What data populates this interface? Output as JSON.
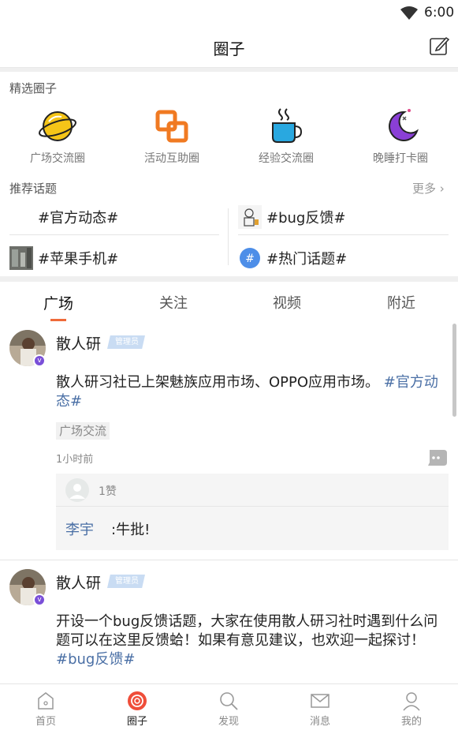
{
  "status_bar": {
    "time": "6:00"
  },
  "header": {
    "title": "圈子"
  },
  "featured": {
    "label": "精选圈子",
    "circles": [
      {
        "label": "广场交流圈",
        "icon": "planet-icon"
      },
      {
        "label": "活动互助圈",
        "icon": "link-squares-icon"
      },
      {
        "label": "经验交流圈",
        "icon": "coffee-cup-icon"
      },
      {
        "label": "晚睡打卡圈",
        "icon": "moon-icon"
      }
    ]
  },
  "topics": {
    "label": "推荐话题",
    "more": "更多",
    "items": [
      {
        "text": "#官方动态#"
      },
      {
        "text": "#bug反馈#"
      },
      {
        "text": "#苹果手机#"
      },
      {
        "text": "#热门话题#"
      }
    ]
  },
  "tabs": [
    "广场",
    "关注",
    "视频",
    "附近"
  ],
  "posts": [
    {
      "author": "散人研",
      "badge": "管理员",
      "content": "散人研习社已上架魅族应用市场、OPPO应用市场。",
      "hashtag": "#官方动态#",
      "circle_tag": "广场交流",
      "time": "1小时前",
      "likes": "1赞",
      "comment_user": "李宇",
      "comment_text": ":牛批!"
    },
    {
      "author": "散人研",
      "badge": "管理员",
      "content": "开设一个bug反馈话题，大家在使用散人研习社时遇到什么问题可以在这里反馈蛤！如果有意见建议，也欢迎一起探讨！",
      "hashtag": "#bug反馈#"
    }
  ],
  "bottom_nav": [
    {
      "label": "首页",
      "icon": "home-icon"
    },
    {
      "label": "圈子",
      "icon": "circle-target-icon"
    },
    {
      "label": "发现",
      "icon": "search-icon"
    },
    {
      "label": "消息",
      "icon": "mail-icon"
    },
    {
      "label": "我的",
      "icon": "person-icon"
    }
  ],
  "colors": {
    "accent": "#ef6b3a",
    "hashtag": "#4a6fa5",
    "badge": "#c9dcf3"
  }
}
